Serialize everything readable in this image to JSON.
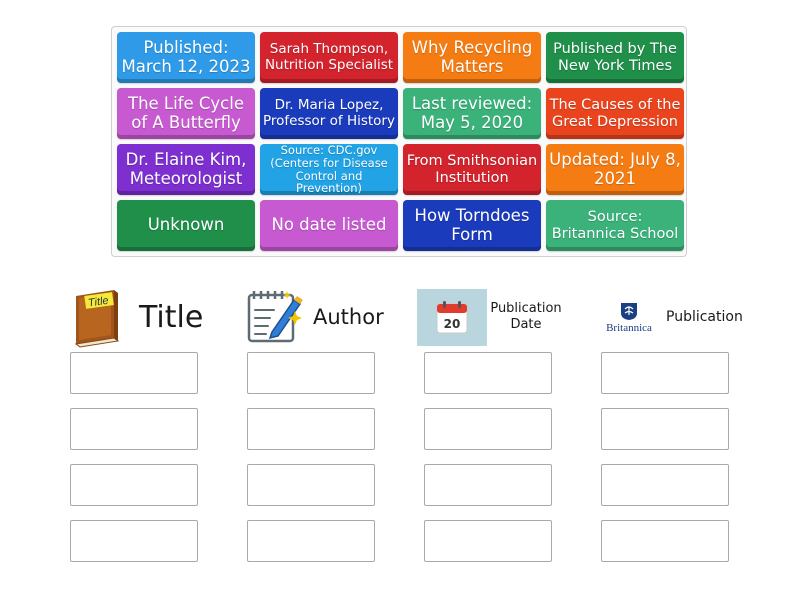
{
  "tiles": [
    {
      "text": "Published: March 12, 2023",
      "color": "#2f9be8"
    },
    {
      "text": "Sarah Thompson, Nutrition Specialist",
      "color": "#d3232d"
    },
    {
      "text": "Why Recycling Matters",
      "color": "#f57c12"
    },
    {
      "text": "Published by The New York Times",
      "color": "#1f8f4a"
    },
    {
      "text": "The Life Cycle of A Butterfly",
      "color": "#c85ad1"
    },
    {
      "text": "Dr. Maria Lopez, Professor of History",
      "color": "#1b3bbd"
    },
    {
      "text": "Last reviewed: May 5, 2020",
      "color": "#3ab27a"
    },
    {
      "text": "The Causes of the Great Depression",
      "color": "#e9441e"
    },
    {
      "text": "Dr. Elaine Kim, Meteorologist",
      "color": "#7d2fcf"
    },
    {
      "text": "Source: CDC.gov (Centers for Disease Control and Prevention)",
      "color": "#21a3e6"
    },
    {
      "text": "From Smithsonian Institution",
      "color": "#d3232d"
    },
    {
      "text": "Updated: July 8, 2021",
      "color": "#f57c12"
    },
    {
      "text": "Unknown",
      "color": "#1f8f4a"
    },
    {
      "text": "No date listed",
      "color": "#c85ad1"
    },
    {
      "text": "How Torndoes Form",
      "color": "#1b3bbd"
    },
    {
      "text": "Source: Britannica School",
      "color": "#3ab27a"
    }
  ],
  "columns": [
    {
      "label": "Title",
      "icon": "book-icon",
      "icon_text": "Title"
    },
    {
      "label": "Author",
      "icon": "notepad-pencil-icon"
    },
    {
      "label": "Publication Date",
      "icon": "calendar-icon",
      "icon_text": "20"
    },
    {
      "label": "Publication",
      "icon": "britannica-logo",
      "icon_text": "Britannica"
    }
  ]
}
